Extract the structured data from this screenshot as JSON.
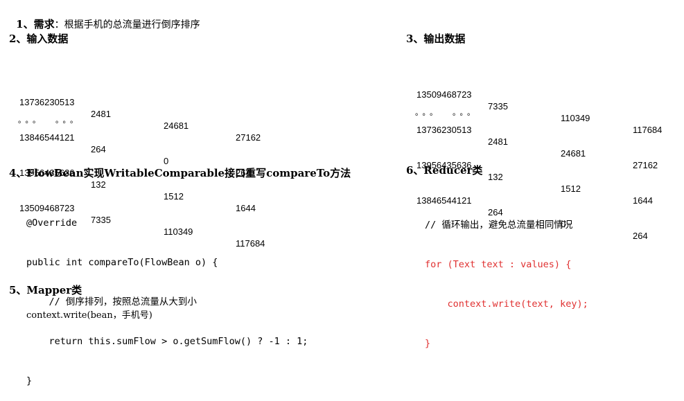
{
  "section1": {
    "heading": "1、需求",
    "text": "：根据手机的总流量进行倒序排序"
  },
  "section2": {
    "heading": "2、输入数据",
    "rows": [
      [
        "13736230513",
        "2481",
        "24681",
        "27162"
      ],
      [
        "13846544121",
        "264",
        "0",
        "264"
      ],
      [
        "13956435636",
        "132",
        "1512",
        "1644"
      ],
      [
        "13509468723",
        "7335",
        "110349",
        "117684"
      ]
    ],
    "ellipsis": "。。。  。。。"
  },
  "section3": {
    "heading": "3、输出数据",
    "rows": [
      [
        "13509468723",
        "7335",
        "110349",
        "117684"
      ],
      [
        "13736230513",
        "2481",
        "24681",
        "27162"
      ],
      [
        "13956435636",
        "132",
        "1512",
        "1644"
      ],
      [
        "13846544121",
        "264",
        "0",
        "264"
      ]
    ],
    "ellipsis": "。。。  。。。"
  },
  "section4": {
    "heading": "4、FlowBean实现WritableComparable接口重写compareTo方法",
    "code": [
      "@Override",
      "public int compareTo(FlowBean o) {",
      "    // 倒序排列，按照总流量从大到小",
      "    return this.sumFlow > o.getSumFlow() ? -1 : 1;",
      "}"
    ]
  },
  "section5": {
    "heading": "5、Mapper类",
    "text": "context.write(bean，手机号)"
  },
  "section6": {
    "heading": "6、Reducer类",
    "comment": "// 循环输出，避免总流量相同情况",
    "code": [
      "for (Text text : values) {",
      "    context.write(text, key);",
      "}"
    ],
    "code_color": "#e03030"
  }
}
